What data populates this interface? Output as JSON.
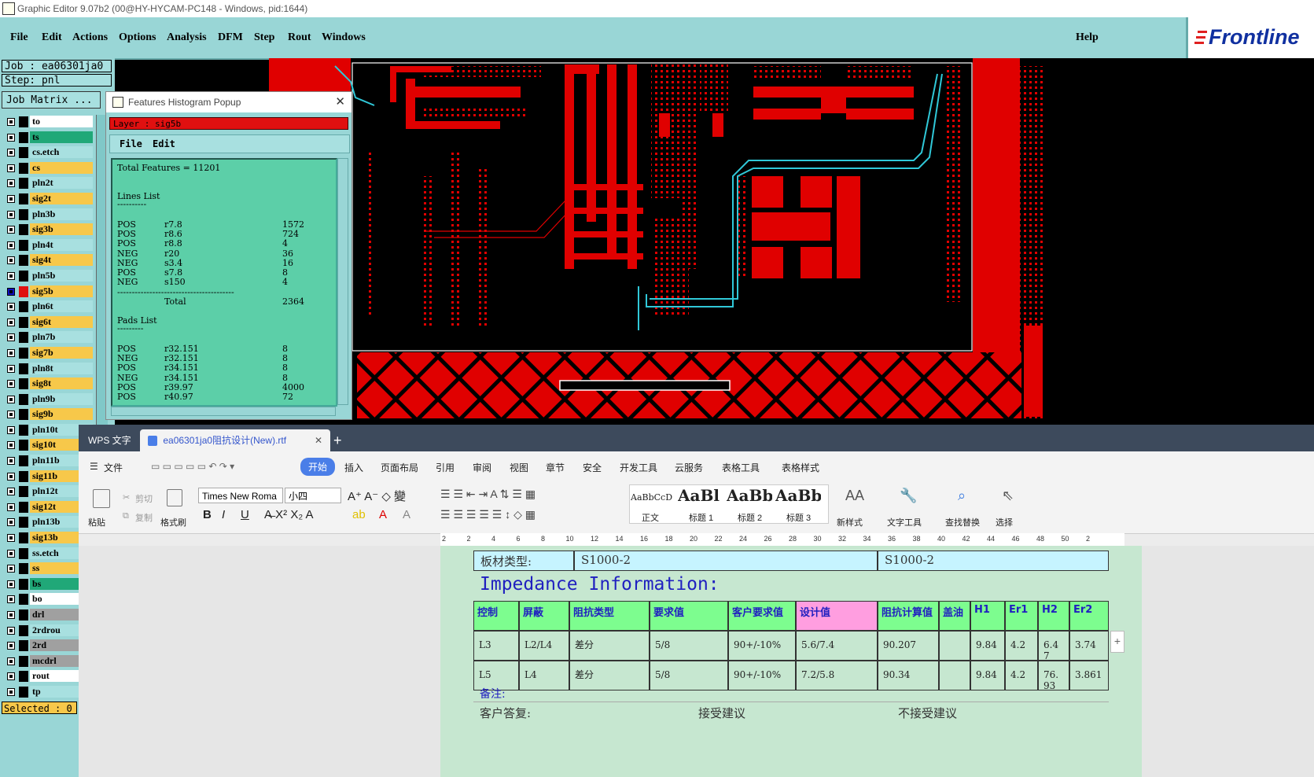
{
  "window": {
    "title": "Graphic Editor 9.07b2 (00@HY-HYCAM-PC148 - Windows, pid:1644)"
  },
  "menubar": {
    "items": [
      "File",
      "Edit",
      "Actions",
      "Options",
      "Analysis",
      "DFM",
      "Step",
      "Rout",
      "Windows"
    ],
    "help": "Help",
    "logo": "Frontline"
  },
  "left_panel": {
    "job": "Job : ea06301ja0",
    "step": "Step: pnl",
    "job_matrix": "Job Matrix ...",
    "selected": "Selected : 0",
    "layers": [
      {
        "name": "to",
        "color": "#ffffff"
      },
      {
        "name": "ts",
        "color": "#20a878"
      },
      {
        "name": "cs.etch",
        "color": "#a8e0e0"
      },
      {
        "name": "cs",
        "color": "#f7c84a"
      },
      {
        "name": "pln2t",
        "color": "#a8e0e0"
      },
      {
        "name": "sig2t",
        "color": "#f7c84a"
      },
      {
        "name": "pln3b",
        "color": "#a8e0e0"
      },
      {
        "name": "sig3b",
        "color": "#f7c84a"
      },
      {
        "name": "pln4t",
        "color": "#a8e0e0"
      },
      {
        "name": "sig4t",
        "color": "#f7c84a"
      },
      {
        "name": "pln5b",
        "color": "#a8e0e0"
      },
      {
        "name": "sig5b",
        "color": "#f7c84a"
      },
      {
        "name": "pln6t",
        "color": "#a8e0e0"
      },
      {
        "name": "sig6t",
        "color": "#f7c84a"
      },
      {
        "name": "pln7b",
        "color": "#a8e0e0"
      },
      {
        "name": "sig7b",
        "color": "#f7c84a"
      },
      {
        "name": "pln8t",
        "color": "#a8e0e0"
      },
      {
        "name": "sig8t",
        "color": "#f7c84a"
      },
      {
        "name": "pln9b",
        "color": "#a8e0e0"
      },
      {
        "name": "sig9b",
        "color": "#f7c84a"
      },
      {
        "name": "pln10t",
        "color": "#a8e0e0"
      },
      {
        "name": "sig10t",
        "color": "#f7c84a"
      },
      {
        "name": "pln11b",
        "color": "#a8e0e0"
      },
      {
        "name": "sig11b",
        "color": "#f7c84a"
      },
      {
        "name": "pln12t",
        "color": "#a8e0e0"
      },
      {
        "name": "sig12t",
        "color": "#f7c84a"
      },
      {
        "name": "pln13b",
        "color": "#a8e0e0"
      },
      {
        "name": "sig13b",
        "color": "#f7c84a"
      },
      {
        "name": "ss.etch",
        "color": "#a8e0e0"
      },
      {
        "name": "ss",
        "color": "#f7c84a"
      },
      {
        "name": "bs",
        "color": "#20a878"
      },
      {
        "name": "bo",
        "color": "#ffffff"
      },
      {
        "name": "drl",
        "color": "#a0a0a0"
      },
      {
        "name": "2rdrou",
        "color": "#a8e0e0"
      },
      {
        "name": "2rd",
        "color": "#a0a0a0"
      },
      {
        "name": "mcdrl",
        "color": "#a0a0a0"
      },
      {
        "name": "rout",
        "color": "#ffffff"
      },
      {
        "name": "tp",
        "color": "#a8e0e0"
      }
    ]
  },
  "histogram": {
    "title": "Features Histogram Popup",
    "layer": "Layer :  sig5b",
    "menu": [
      "File",
      "Edit"
    ],
    "total": "Total Features = 11201",
    "lines_heading": "Lines List",
    "underline": "----------",
    "lines": [
      {
        "pol": "POS",
        "sym": "r7.8",
        "count": "1572"
      },
      {
        "pol": "POS",
        "sym": "r8.6",
        "count": "724"
      },
      {
        "pol": "POS",
        "sym": "r8.8",
        "count": "4"
      },
      {
        "pol": "NEG",
        "sym": "r20",
        "count": "36"
      },
      {
        "pol": "NEG",
        "sym": "s3.4",
        "count": "16"
      },
      {
        "pol": "POS",
        "sym": "s7.8",
        "count": "8"
      },
      {
        "pol": "NEG",
        "sym": "s150",
        "count": "4"
      }
    ],
    "separator": "----------------------------------------",
    "total_label": "Total",
    "total_value": "2364",
    "pads_heading": "Pads List",
    "pads_underline": "---------",
    "pads": [
      {
        "pol": "POS",
        "sym": "r32.151",
        "count": "8"
      },
      {
        "pol": "NEG",
        "sym": "r32.151",
        "count": "8"
      },
      {
        "pol": "POS",
        "sym": "r34.151",
        "count": "8"
      },
      {
        "pol": "NEG",
        "sym": "r34.151",
        "count": "8"
      },
      {
        "pol": "POS",
        "sym": "r39.97",
        "count": "4000"
      },
      {
        "pol": "POS",
        "sym": "r40.97",
        "count": "72"
      }
    ]
  },
  "wps": {
    "tabs": {
      "app": "WPS 文字",
      "doc": "ea06301ja0阻抗设计(New).rtf",
      "add": "+"
    },
    "menu": {
      "file": "文件",
      "items": [
        "开始",
        "插入",
        "页面布局",
        "引用",
        "审阅",
        "视图",
        "章节",
        "安全",
        "开发工具",
        "云服务",
        "表格工具",
        "表格样式"
      ]
    },
    "ribbon": {
      "paste": "粘贴",
      "cut": "剪切",
      "copy": "复制",
      "format_painter": "格式刷",
      "font": "Times New Roma",
      "size": "小四",
      "styles": [
        {
          "preview": "AaBbCcD",
          "label": "正文"
        },
        {
          "preview": "AaBl",
          "label": "标题 1"
        },
        {
          "preview": "AaBb(",
          "label": "标题 2"
        },
        {
          "preview": "AaBbC",
          "label": "标题 3"
        }
      ],
      "new_style": "新样式",
      "text_tools": "文字工具",
      "find_replace": "查找替换",
      "select": "选择"
    },
    "ruler": [
      "2",
      "2",
      "4",
      "6",
      "8",
      "10",
      "12",
      "14",
      "16",
      "18",
      "20",
      "22",
      "24",
      "26",
      "28",
      "30",
      "32",
      "34",
      "36",
      "38",
      "40",
      "42",
      "44",
      "46",
      "48",
      "50",
      "2"
    ],
    "doc": {
      "board_label": "板材类型:",
      "board_value1": "S1000-2",
      "board_value2": "S1000-2",
      "heading": "Impedance Information:",
      "columns": [
        "控制",
        "屏蔽",
        "阻抗类型",
        "要求值",
        "客户要求值",
        "设计值",
        "阻抗计算值",
        "盖油",
        "H1",
        "Er1",
        "H2",
        "Er2"
      ],
      "rows": [
        [
          "L3",
          "L2/L4",
          "差分",
          "5/8",
          "90+/-10%",
          "5.6/7.4",
          "90.207",
          "",
          "9.84",
          "4.2",
          "6.47",
          "3.74"
        ],
        [
          "L5",
          "L4",
          "差分",
          "5/8",
          "90+/-10%",
          "7.2/5.8",
          "90.34",
          "",
          "9.84",
          "4.2",
          "76.93",
          "3.861"
        ]
      ],
      "note": "备注:",
      "reply_label": "客户答复:",
      "accept": "接受建议",
      "reject": "不接受建议"
    }
  }
}
